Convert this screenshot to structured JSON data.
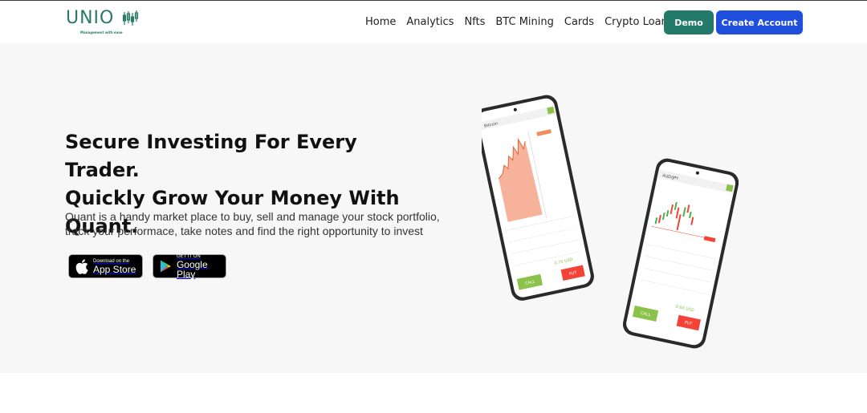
{
  "brand": {
    "name": "UNIO",
    "tagline": "Management with ease",
    "accent_color": "#237a6b"
  },
  "nav": {
    "items": [
      "Home",
      "Analytics",
      "Nfts",
      "BTC Mining",
      "Cards",
      "Crypto Loans"
    ]
  },
  "header_buttons": {
    "demo": "Demo",
    "create": "Create Account",
    "primary_color": "#1f4fdc"
  },
  "hero": {
    "title_line1": "Secure Investing For Every Trader.",
    "title_line2": "Quickly Grow Your Money With",
    "title_line3": "Quant.",
    "description": "Quant is a handy market place to buy, sell and manage your stock portfolio, track your performace, take notes and find the right opportunity to invest"
  },
  "stores": {
    "apple_small": "Download on the",
    "apple_big": "App Store",
    "google_small": "GET IT ON",
    "google_big": "Google Play"
  },
  "phone_left": {
    "pair": "Bitcoin",
    "call": "CALL",
    "put": "PUT",
    "value": "0.70 USD"
  },
  "phone_right": {
    "pair": "AUD/JPY",
    "call": "CALL",
    "put": "PUT",
    "value": "0.60 USD"
  }
}
